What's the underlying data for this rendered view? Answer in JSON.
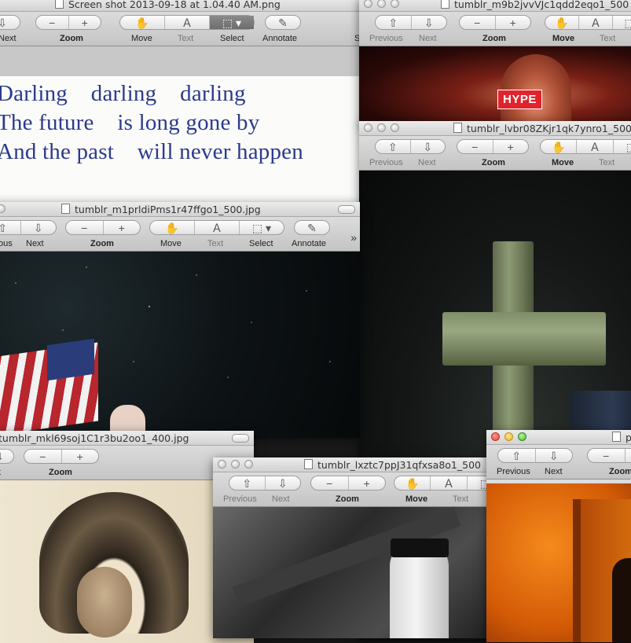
{
  "colors": {
    "poem_text": "#2c3a8c",
    "hype_red": "#e2232c"
  },
  "windows": {
    "screenshot": {
      "title": "Screen shot 2013-09-18 at 1.04.40 AM.png",
      "labels": {
        "next": "Next",
        "zoom": "Zoom",
        "move": "Move",
        "text": "Text",
        "select": "Select",
        "annotate": "Annotate",
        "partial_s": "S"
      },
      "poem": [
        "Darling    darling    darling",
        "The future    is long gone by",
        "And the past    will never happen"
      ]
    },
    "m9b2": {
      "title": "tumblr_m9b2jvvVJc1qdd2eqo1_500",
      "labels": {
        "previous": "Previous",
        "next": "Next",
        "zoom": "Zoom",
        "move": "Move",
        "text": "Text"
      },
      "badge": "HYPE"
    },
    "lvbr": {
      "title": "tumblr_lvbr08ZKjr1qk7ynro1_500",
      "labels": {
        "previous": "Previous",
        "next": "Next",
        "zoom": "Zoom",
        "move": "Move",
        "text": "Text"
      }
    },
    "m1prl": {
      "title": "tumblr_m1prldiPms1r47ffgo1_500.jpg",
      "labels": {
        "previous": "ous",
        "next": "Next",
        "zoom": "Zoom",
        "move": "Move",
        "text": "Text",
        "select": "Select",
        "annotate": "Annotate",
        "more": "»"
      }
    },
    "mkl6": {
      "title": "tumblr_mkl69soj1C1r3bu2oo1_400.jpg",
      "labels": {
        "next": "t",
        "zoom": "Zoom"
      }
    },
    "lxzt": {
      "title": "tumblr_lxztc7ppJ31qfxsa8o1_500",
      "labels": {
        "previous": "Previous",
        "next": "Next",
        "zoom": "Zoom",
        "move": "Move",
        "text": "Text"
      }
    },
    "orange": {
      "title": "p",
      "labels": {
        "previous": "Previous",
        "next": "Next",
        "zoom": "Zoom"
      }
    }
  }
}
